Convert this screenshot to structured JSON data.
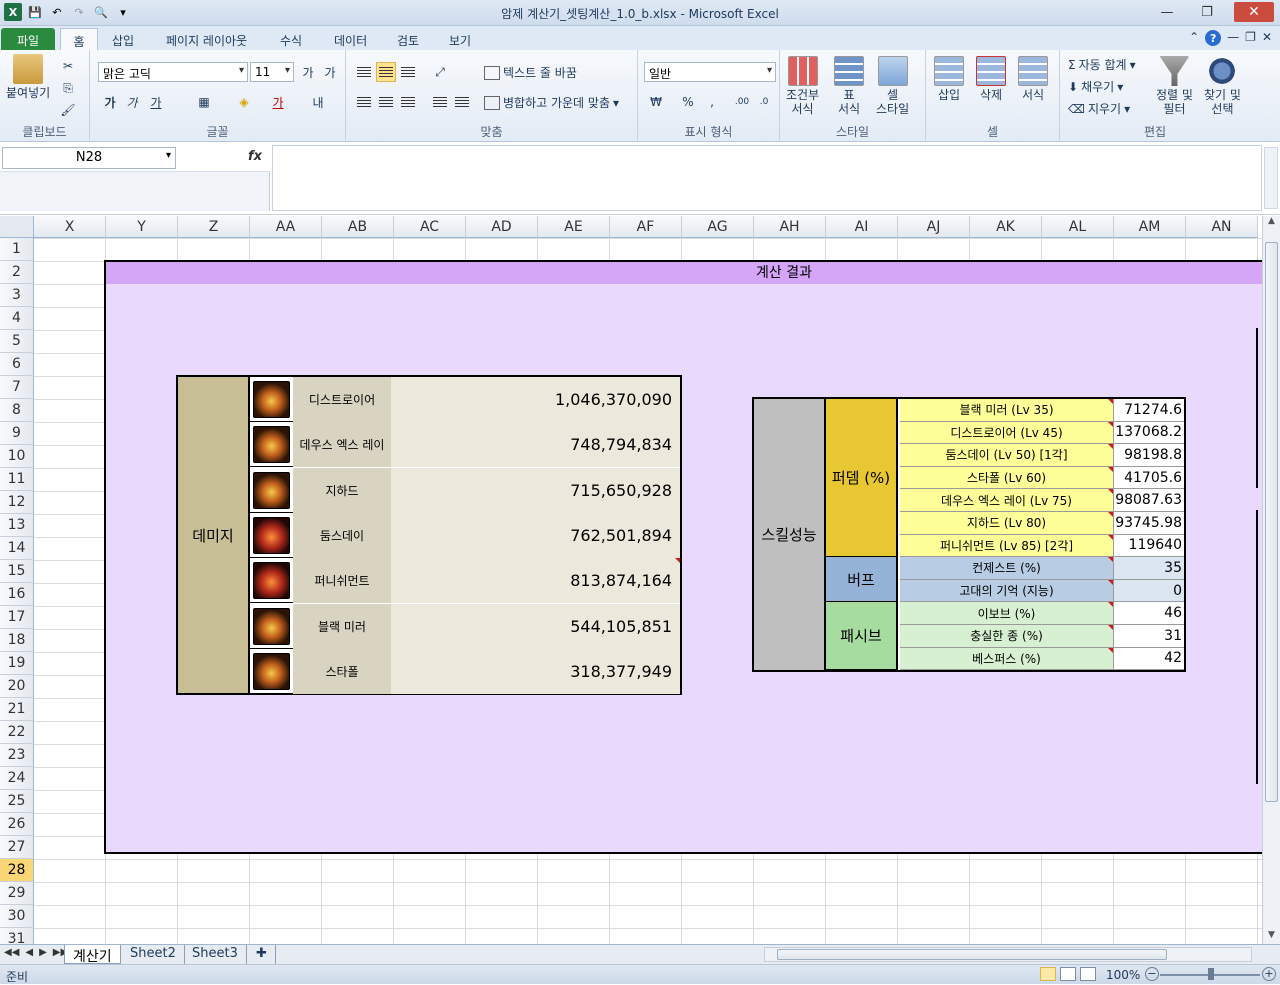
{
  "window": {
    "title": "암제 계산기_셋팅계산_1.0_b.xlsx - Microsoft Excel"
  },
  "tabs": [
    "파일",
    "홈",
    "삽입",
    "페이지 레이아웃",
    "수식",
    "데이터",
    "검토",
    "보기"
  ],
  "ribbon": {
    "clipboard": {
      "paste": "붙여넣기",
      "label": "클립보드"
    },
    "font": {
      "name": "맑은 고딕",
      "size": "11",
      "label": "글꼴"
    },
    "align": {
      "wrap": "텍스트 줄 바꿈",
      "merge": "병합하고 가운데 맞춤",
      "label": "맞춤"
    },
    "number": {
      "format": "일반",
      "label": "표시 형식"
    },
    "style": {
      "cond": "조건부\n서식",
      "table": "표\n서식",
      "cell": "셀\n스타일",
      "label": "스타일"
    },
    "cells": {
      "insert": "삽입",
      "delete": "삭제",
      "format": "서식",
      "label": "셀"
    },
    "edit": {
      "autosum": "자동 합계",
      "fill": "채우기",
      "clear": "지우기",
      "sort": "정렬 및\n필터",
      "find": "찾기 및\n선택",
      "label": "편집"
    }
  },
  "formula": {
    "namebox": "N28",
    "fx": "fx"
  },
  "columns": [
    "X",
    "Y",
    "Z",
    "AA",
    "AB",
    "AC",
    "AD",
    "AE",
    "AF",
    "AG",
    "AH",
    "AI",
    "AJ",
    "AK",
    "AL",
    "AM",
    "AN"
  ],
  "rows": [
    "1",
    "2",
    "3",
    "4",
    "5",
    "6",
    "7",
    "8",
    "9",
    "10",
    "11",
    "12",
    "13",
    "14",
    "15",
    "16",
    "17",
    "18",
    "19",
    "20",
    "21",
    "22",
    "23",
    "24",
    "25",
    "26",
    "27",
    "28",
    "29",
    "30",
    "31"
  ],
  "panel": {
    "title": "계산 결과"
  },
  "damage": {
    "label": "데미지",
    "items": [
      {
        "name": "디스트로이어",
        "value": "1,046,370,090"
      },
      {
        "name": "데우스 엑스 레이",
        "value": "748,794,834"
      },
      {
        "name": "지하드",
        "value": "715,650,928"
      },
      {
        "name": "둠스데이",
        "value": "762,501,894"
      },
      {
        "name": "퍼니쉬먼트",
        "value": "813,874,164"
      },
      {
        "name": "블랙 미러",
        "value": "544,105,851"
      },
      {
        "name": "스타폴",
        "value": "318,377,949"
      }
    ]
  },
  "skill": {
    "label": "스킬성능",
    "categories": [
      {
        "name": "퍼뎀 (%)",
        "color": "#e8c832",
        "rowcolor": "#fefe99",
        "items": [
          {
            "name": "블랙 미러 (Lv 35)",
            "value": "71274.6"
          },
          {
            "name": "디스트로이어 (Lv 45)",
            "value": "137068.2"
          },
          {
            "name": "둠스데이 (Lv 50) [1각]",
            "value": "98198.8"
          },
          {
            "name": "스타폴 (Lv 60)",
            "value": "41705.6"
          },
          {
            "name": "데우스 엑스 레이 (Lv 75)",
            "value": "98087.63"
          },
          {
            "name": "지하드 (Lv 80)",
            "value": "93745.98"
          },
          {
            "name": "퍼니쉬먼트 (Lv 85) [2각]",
            "value": "119640"
          }
        ]
      },
      {
        "name": "버프",
        "color": "#95b3d7",
        "rowcolor": "#b8cce4",
        "items": [
          {
            "name": "컨제스트 (%)",
            "value": "35"
          },
          {
            "name": "고대의 기억 (지능)",
            "value": "0"
          }
        ]
      },
      {
        "name": "패시브",
        "color": "#a6dca0",
        "rowcolor": "#d8f0d2",
        "items": [
          {
            "name": "이보브 (%)",
            "value": "46"
          },
          {
            "name": "충실한 종 (%)",
            "value": "31"
          },
          {
            "name": "베스퍼스 (%)",
            "value": "42"
          }
        ]
      }
    ]
  },
  "sheets": [
    "계산기",
    "Sheet2",
    "Sheet3"
  ],
  "status": {
    "ready": "준비",
    "zoom": "100%"
  }
}
